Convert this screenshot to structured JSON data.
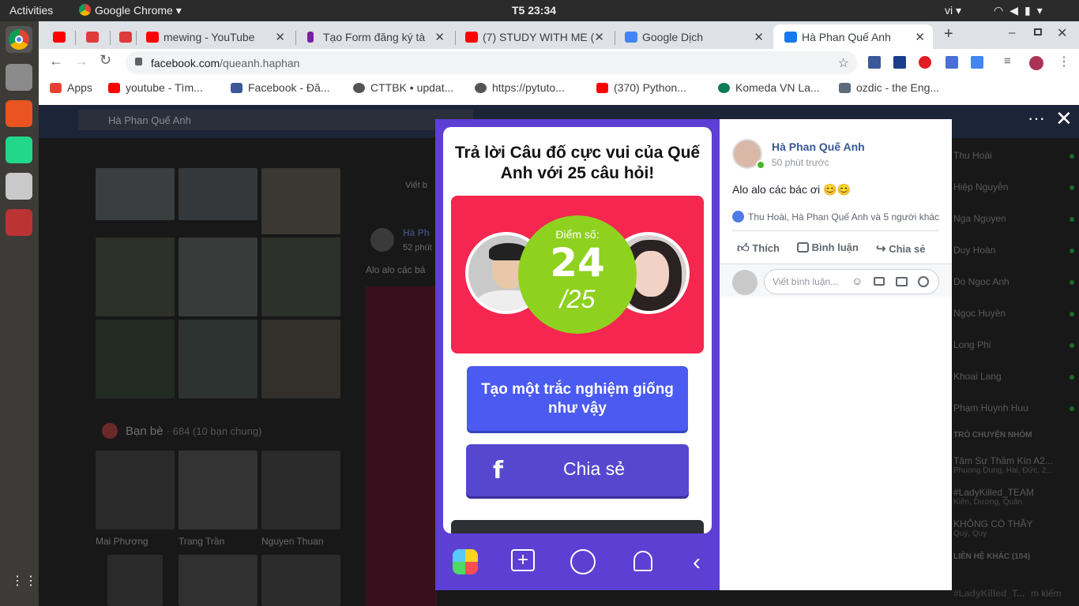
{
  "topbar": {
    "activities": "Activities",
    "app": "Google Chrome",
    "clock": "T5 23:34",
    "lang": "vi"
  },
  "tabs": [
    {
      "label": "",
      "fav": "#e52d27"
    },
    {
      "label": "",
      "fav": "#e03b3b"
    },
    {
      "label": "",
      "fav": "#e03b3b"
    },
    {
      "label": "mewing - YouTube",
      "fav": "#ff0000"
    },
    {
      "label": "Tạo Form đăng ký tà",
      "fav": "#7b1fa2"
    },
    {
      "label": "(7) STUDY WITH ME (",
      "fav": "#ff0000"
    },
    {
      "label": "Google Dịch",
      "fav": "#4285f4"
    },
    {
      "label": "Hà Phan Quế Anh",
      "fav": "#1877f2"
    }
  ],
  "address": {
    "domain": "facebook.com",
    "path": "/queanh.haphan"
  },
  "bookmarks": [
    {
      "label": "Apps",
      "color": "#e94235"
    },
    {
      "label": "youtube - Tìm...",
      "color": "#ff0000"
    },
    {
      "label": "Facebook - Đă...",
      "color": "#3b5998"
    },
    {
      "label": "CTTBK • updat...",
      "color": "#555555"
    },
    {
      "label": "https://pytuto...",
      "color": "#555555"
    },
    {
      "label": "(370) Python...",
      "color": "#ff0000"
    },
    {
      "label": "Komeda VN La...",
      "color": "#0c7c59"
    },
    {
      "label": "ozdic - the Eng...",
      "color": "#5a6b7a"
    }
  ],
  "fb": {
    "search": "Hà Phan Quế Anh",
    "friends_label": "Bạn bè",
    "friends_count": "· 684 (10 bạn chung)",
    "friends": [
      "Mai Phương",
      "Trang Trần",
      "Nguyen Thuan"
    ],
    "bg_name": "Hà Ph",
    "bg_time": "52 phút",
    "bg_comment": "Viết b",
    "bg_text": "Alo alo các bá"
  },
  "quiz": {
    "title": "Trả lời Câu đố cực vui của Quế Anh với 25 câu hỏi!",
    "score_label": "Điểm số:",
    "score": "24",
    "total": "/25",
    "create_btn": "Tạo một trắc nghiệm giống như vậy",
    "share_btn": "Chia sẻ"
  },
  "post": {
    "name": "Hà Phan Quế Anh",
    "time": "50 phút trước",
    "text": "Alo alo các bác ơi 😊😊",
    "reactions": "Thu Hoài, Hà Phan Quế Anh và 5 người khác",
    "like": "Thích",
    "comment": "Bình luận",
    "share": "Chia sẻ",
    "comment_placeholder": "Viết bình luận..."
  },
  "chat": {
    "contacts": [
      "Thu Hoài",
      "Hiệp Nguyễn",
      "Nga Nguyen",
      "Duy Hoàn",
      "Do Ngoc Anh",
      "Ngọc Huyền",
      "Long Phi",
      "Khoai Lang",
      "Phạm Huynh Huu"
    ],
    "group_header": "TRÒ CHUYỆN NHÓM",
    "groups": [
      {
        "name": "Tâm Sự Thầm Kín A2...",
        "sub": "Phuong Dung, Hai, Đức, 2..."
      },
      {
        "name": "#LadyKilled_TEAM",
        "sub": "Kiên, Dương, Quân"
      },
      {
        "name": "KHÔNG CÓ THẦY",
        "sub": "Quý, Quy"
      }
    ],
    "other_header": "LIÊN HỆ KHÁC (104)",
    "bottom_chat": "#LadyKilled_T...",
    "bottom_search": "m kiếm"
  }
}
